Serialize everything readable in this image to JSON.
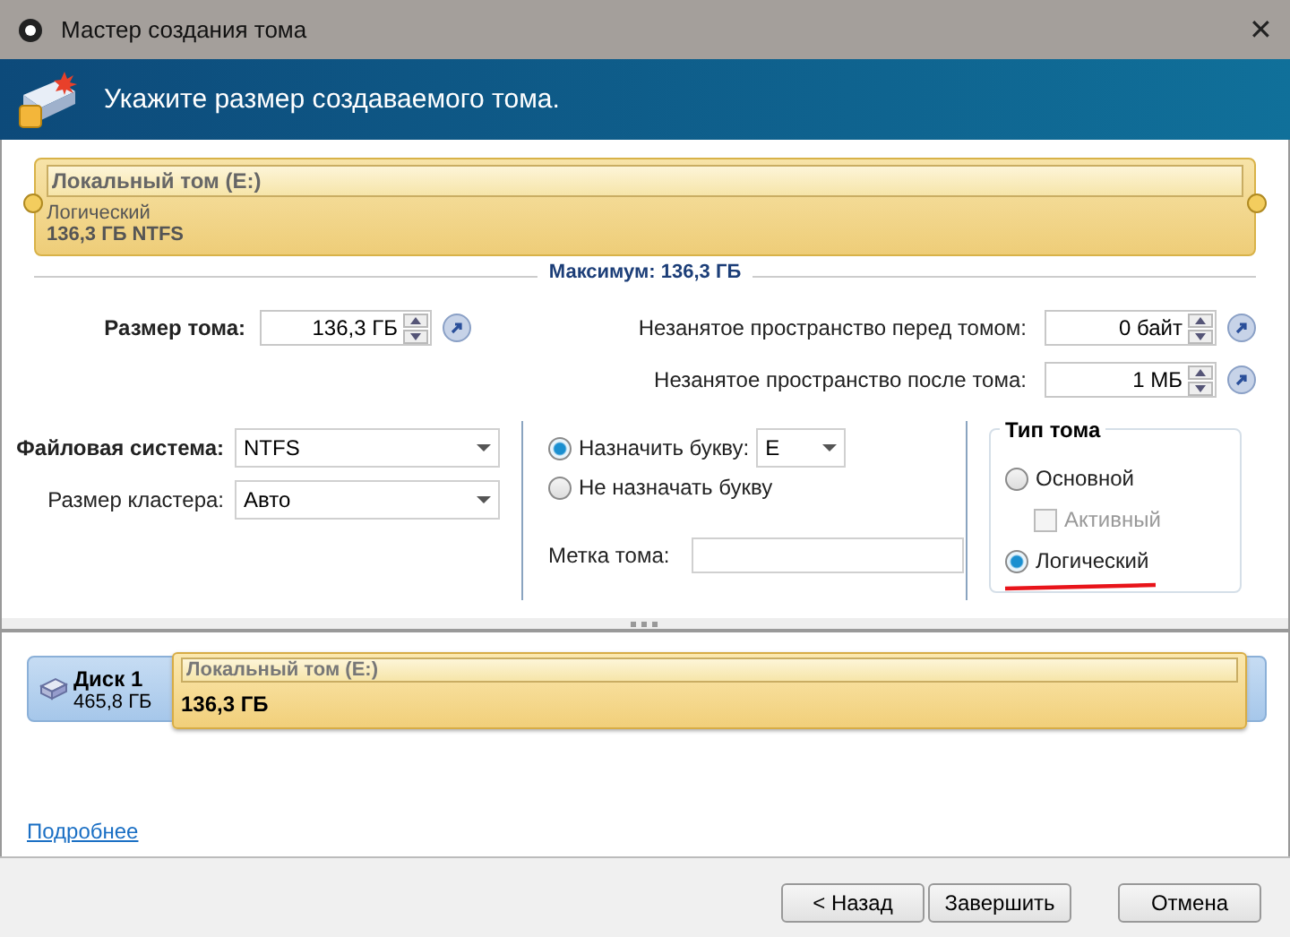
{
  "window": {
    "title": "Мастер создания тома",
    "close": "✕"
  },
  "header": {
    "title": "Укажите размер создаваемого тома."
  },
  "volume_bar": {
    "name": "Локальный том (E:)",
    "type": "Логический",
    "size_fs": "136,3 ГБ NTFS",
    "maximum": "Максимум: 136,3 ГБ"
  },
  "volume_size": {
    "label": "Размер тома:",
    "value": "136,3 ГБ"
  },
  "space_fields": [
    {
      "label": "Незанятое пространство перед томом:",
      "value": "0 байт"
    },
    {
      "label": "Незанятое пространство после тома:",
      "value": "1 МБ"
    }
  ],
  "file_system": {
    "label": "Файловая система:",
    "value": "NTFS"
  },
  "cluster_size": {
    "label": "Размер кластера:",
    "value": "Авто"
  },
  "letter_options": [
    {
      "label": "Назначить букву:",
      "selected": true
    },
    {
      "label": "Не назначать букву",
      "selected": false
    }
  ],
  "drive_letter": "E",
  "volume_label": {
    "label": "Метка тома:"
  },
  "volume_type": {
    "title": "Тип тома",
    "options": [
      {
        "kind": "radio",
        "label": "Основной",
        "selected": false
      },
      {
        "kind": "checkbox",
        "label": "Активный",
        "checked": false,
        "disabled": true
      },
      {
        "kind": "radio",
        "label": "Логический",
        "selected": true
      }
    ]
  },
  "disk_map": {
    "disk": "Диск 1",
    "disk_size": "465,8 ГБ",
    "volume_name": "Локальный том (E:)",
    "volume_size": "136,3 ГБ"
  },
  "link": "Подробнее",
  "buttons": [
    "< Назад",
    "Завершить",
    "Отмена"
  ]
}
